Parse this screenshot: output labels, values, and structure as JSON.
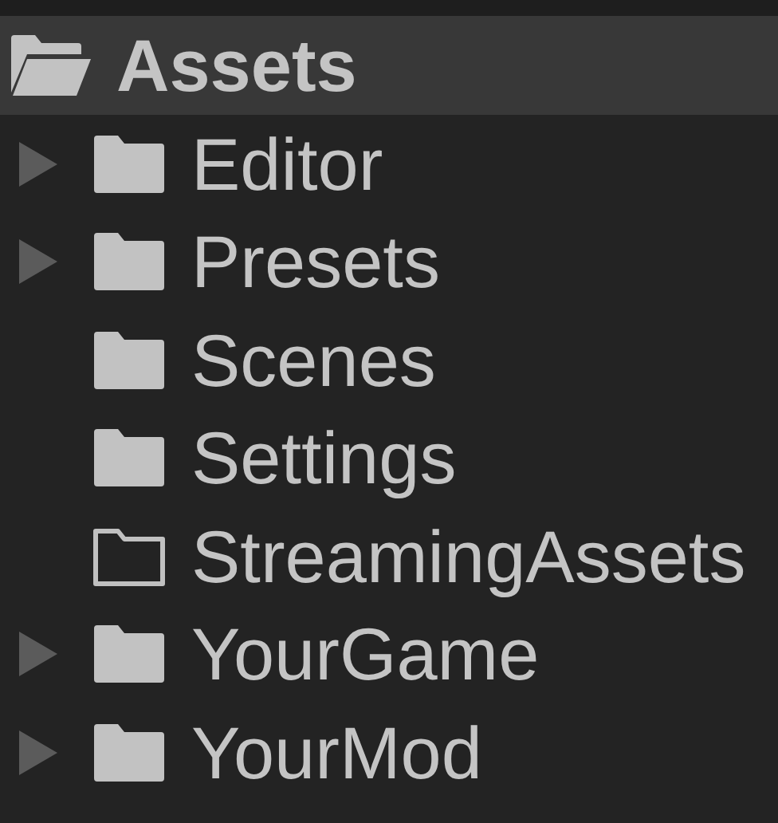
{
  "tree": {
    "label": "Assets",
    "expanded": true,
    "selected": true,
    "children": [
      {
        "label": "Editor",
        "kind": "collapsed",
        "selected": false
      },
      {
        "label": "Presets",
        "kind": "collapsed",
        "selected": false
      },
      {
        "label": "Scenes",
        "kind": "leaf",
        "selected": false
      },
      {
        "label": "Settings",
        "kind": "leaf",
        "selected": false
      },
      {
        "label": "StreamingAssets",
        "kind": "empty",
        "selected": false
      },
      {
        "label": "YourGame",
        "kind": "collapsed",
        "selected": false
      },
      {
        "label": "YourMod",
        "kind": "collapsed",
        "selected": false
      }
    ]
  }
}
